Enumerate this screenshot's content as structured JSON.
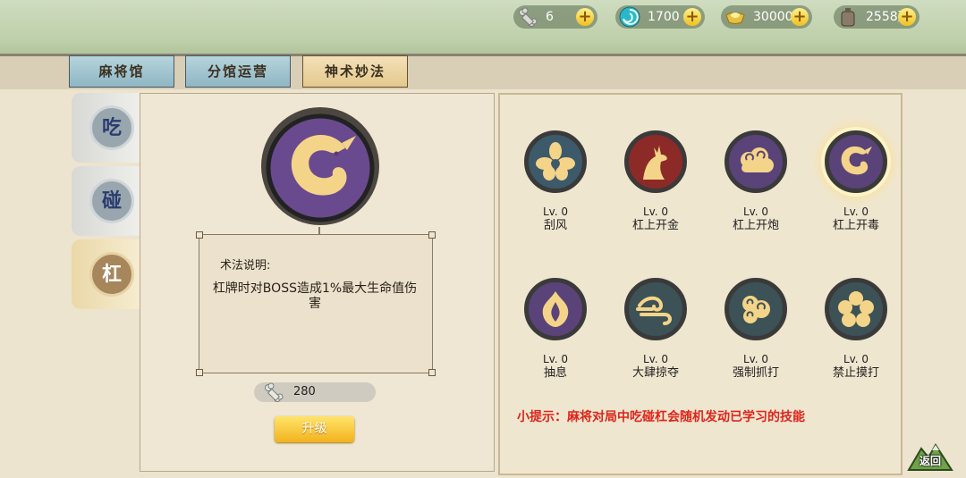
{
  "resources": [
    {
      "icon": "bone-icon",
      "value": "6",
      "color": "#c9cbc7"
    },
    {
      "icon": "swirl-orb-icon",
      "value": "1700",
      "color": "#2ab8c8"
    },
    {
      "icon": "gold-ingot-icon",
      "value": "30000",
      "color": "#e2b73a"
    },
    {
      "icon": "coin-sack-icon",
      "value": "2558万",
      "color": "#8a7a6a"
    }
  ],
  "tabs": [
    {
      "label": "麻将馆",
      "active": false
    },
    {
      "label": "分馆运营",
      "active": false
    },
    {
      "label": "神术妙法",
      "active": true
    }
  ],
  "side_tabs": [
    {
      "label": "吃",
      "active": false
    },
    {
      "label": "碰",
      "active": false
    },
    {
      "label": "杠",
      "active": true
    }
  ],
  "selected_skill": {
    "icon": "dragon-emblem-icon",
    "desc_title": "术法说明:",
    "desc_text": "杠牌时对BOSS造成1%最大生命值伤害",
    "cost_icon": "bone-icon",
    "cost": "280",
    "upgrade_label": "升级"
  },
  "skills": [
    {
      "name": "刮风",
      "level": "Lv. 0",
      "icon": "orchid-flower-icon",
      "bg": "#3d5a6a"
    },
    {
      "name": "杠上开金",
      "level": "Lv. 0",
      "icon": "deer-icon",
      "bg": "#8c2a28"
    },
    {
      "name": "杠上开炮",
      "level": "Lv. 0",
      "icon": "cloud-icon",
      "bg": "#5a4378"
    },
    {
      "name": "杠上开毒",
      "level": "Lv. 0",
      "icon": "dragon-emblem-icon",
      "bg": "#5a4378",
      "selected": true
    },
    {
      "name": "抽息",
      "level": "Lv. 0",
      "icon": "flame-bud-icon",
      "bg": "#5a4378"
    },
    {
      "name": "大肆掠夺",
      "level": "Lv. 0",
      "icon": "wind-swirl-icon",
      "bg": "#3d5256"
    },
    {
      "name": "强制抓打",
      "level": "Lv. 0",
      "icon": "cloud-swirl-icon",
      "bg": "#3d5256"
    },
    {
      "name": "禁止摸打",
      "level": "Lv. 0",
      "icon": "plum-flower-icon",
      "bg": "#3d5256"
    }
  ],
  "hint": "小提示：麻将对局中吃碰杠会随机发动已学习的技能",
  "back_label": "返回"
}
